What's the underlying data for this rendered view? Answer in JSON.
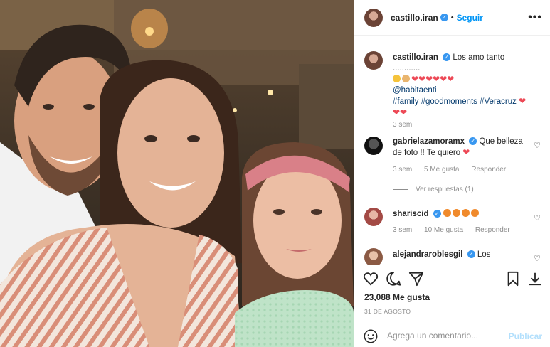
{
  "post": {
    "username": "castillo.iran",
    "follow_label": "Seguir",
    "dot": "•",
    "more_label": "•••"
  },
  "caption": {
    "username": "castillo.iran",
    "text": "Los amo tanto ............",
    "mention": "@habitaenti",
    "hashtags": "#family #goodmoments #Veracruz",
    "time": "3 sem"
  },
  "comments": [
    {
      "username": "gabrielazamoramx",
      "text": "Que belleza de foto !! Te quiero",
      "time": "3 sem",
      "likes": "5 Me gusta",
      "reply": "Responder",
      "view_replies": "Ver respuestas (1)"
    },
    {
      "username": "shariscid",
      "time": "3 sem",
      "likes": "10 Me gusta",
      "reply": "Responder"
    },
    {
      "username": "alejandraroblesgil",
      "text": "Los"
    }
  ],
  "footer": {
    "likes": "23,088 Me gusta",
    "date": "31 DE AGOSTO",
    "comment_placeholder": "Agrega un comentario...",
    "publish_label": "Publicar"
  },
  "icons": {
    "like": "heart-outline-icon",
    "comment": "comment-icon",
    "share": "paper-plane-icon",
    "save": "bookmark-icon",
    "emoji": "emoji-smile-icon"
  },
  "colors": {
    "accent": "#0095f6",
    "verified": "#3897f0",
    "heart": "#ed4956",
    "muted": "#8e8e8e"
  }
}
